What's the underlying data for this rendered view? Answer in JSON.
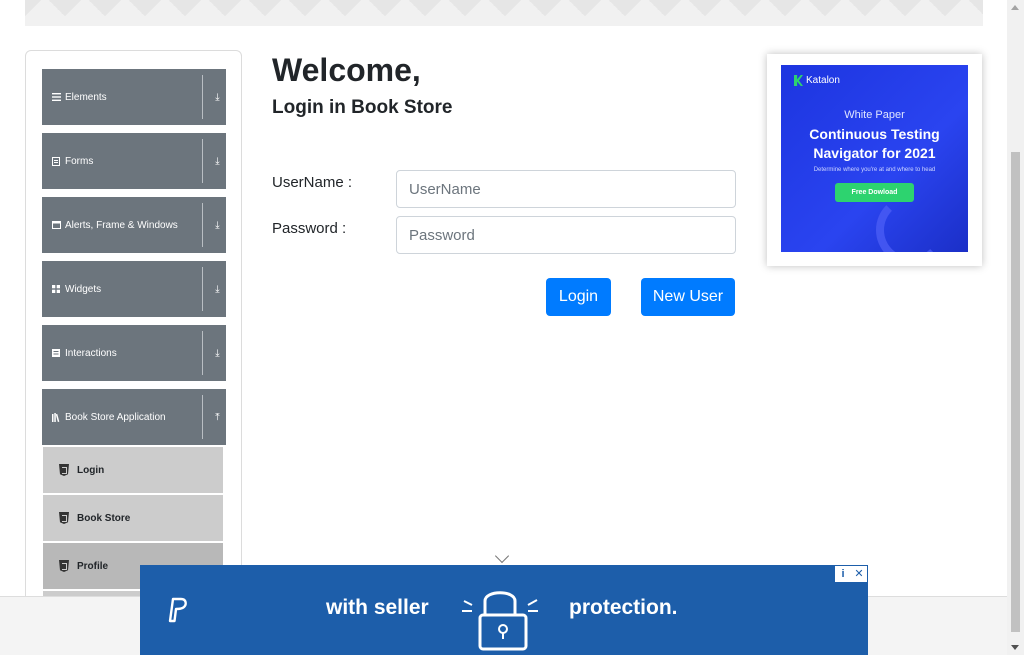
{
  "sidebar": {
    "groups": [
      {
        "label": "Elements",
        "icon": "hamburger-icon"
      },
      {
        "label": "Forms",
        "icon": "form-icon"
      },
      {
        "label": "Alerts, Frame & Windows",
        "icon": "window-icon"
      },
      {
        "label": "Widgets",
        "icon": "grid-icon"
      },
      {
        "label": "Interactions",
        "icon": "list-icon"
      },
      {
        "label": "Book Store Application",
        "icon": "books-icon"
      }
    ],
    "sub_items": [
      {
        "label": "Login"
      },
      {
        "label": "Book Store"
      },
      {
        "label": "Profile"
      }
    ]
  },
  "main": {
    "welcome": "Welcome,",
    "subtitle": "Login in Book Store",
    "username_label": "UserName :",
    "username_placeholder": "UserName",
    "password_label": "Password :",
    "password_placeholder": "Password",
    "login_button": "Login",
    "new_user_button": "New User"
  },
  "ad_right": {
    "brand": "Katalon",
    "kicker": "White Paper",
    "title": "Continuous Testing Navigator for 2021",
    "description": "Determine where you're at and where to head",
    "cta": "Free Dowload"
  },
  "ad_bottom": {
    "left_text": "with seller",
    "right_text": "protection.",
    "choices": [
      "i",
      "✕"
    ]
  },
  "colors": {
    "sidebar_group": "#6c757d",
    "sub_item": "#cccccc",
    "primary": "#007bff",
    "bottom_ad": "#1d5eaa"
  }
}
